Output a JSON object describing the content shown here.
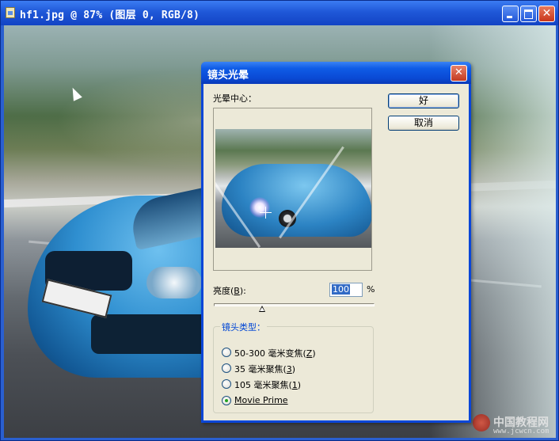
{
  "document_window": {
    "title": "hf1.jpg @ 87% (图层 0, RGB/8)",
    "controls": {
      "minimize": "",
      "maximize": "",
      "close": "✕"
    }
  },
  "watermark": {
    "name": "中国教程网",
    "url": "www.jcwcn.com"
  },
  "dialog": {
    "title": "镜头光晕",
    "close_glyph": "✕",
    "flare_center_label": "光晕中心：",
    "ok_label": "好",
    "cancel_label": "取消",
    "brightness": {
      "label_prefix": "亮度",
      "label_key": "B",
      "label_suffix": ":",
      "value": "100",
      "unit": "%",
      "slider_fraction": 0.3
    },
    "lens_type": {
      "legend": "镜头类型：",
      "options": [
        {
          "text": "50-300 毫米变焦",
          "key": "Z",
          "selected": false
        },
        {
          "text": "35 毫米聚焦",
          "key": "3",
          "selected": false
        },
        {
          "text": "105 毫米聚焦",
          "key": "1",
          "selected": false
        },
        {
          "text": "Movie Prime",
          "key": "M",
          "selected": true
        }
      ]
    }
  }
}
